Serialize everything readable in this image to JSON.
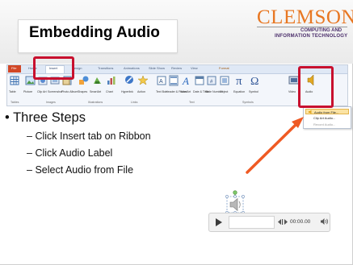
{
  "slide": {
    "title": "Embedding Audio",
    "logo": {
      "name": "CLEMSON",
      "line1": "COMPUTING AND",
      "line2": "INFORMATION TECHNOLOGY"
    }
  },
  "ribbon": {
    "tabs": [
      "File",
      "Home",
      "Insert",
      "Design",
      "Transitions",
      "Animations",
      "Slide Show",
      "Review",
      "View",
      "Format"
    ],
    "buttons": [
      "Table",
      "Picture",
      "Clip Art",
      "Screenshot",
      "Photo Album",
      "Shapes",
      "SmartArt",
      "Chart",
      "Hyperlink",
      "Action",
      "Text Box",
      "Header & Footer",
      "WordArt",
      "Date & Time",
      "Slide Number",
      "Object",
      "Equation",
      "Symbol",
      "Video",
      "Audio"
    ],
    "groups": [
      "Tables",
      "Images",
      "Illustrations",
      "Links",
      "Text",
      "Symbols"
    ],
    "audio_menu": [
      "Audio from File...",
      "Clip Art Audio...",
      "Record Audio..."
    ]
  },
  "content": {
    "bullet": "Three Steps",
    "steps": [
      "Click Insert tab on Ribbon",
      "Click Audio Label",
      "Select Audio from File"
    ]
  },
  "player": {
    "time": "00:00.00"
  },
  "colors": {
    "highlight": "#c8102e",
    "arrow": "#ef5a24",
    "logo_orange": "#e87722",
    "logo_purple": "#4b2e6b",
    "menu_selected": "#fbe3a3"
  }
}
